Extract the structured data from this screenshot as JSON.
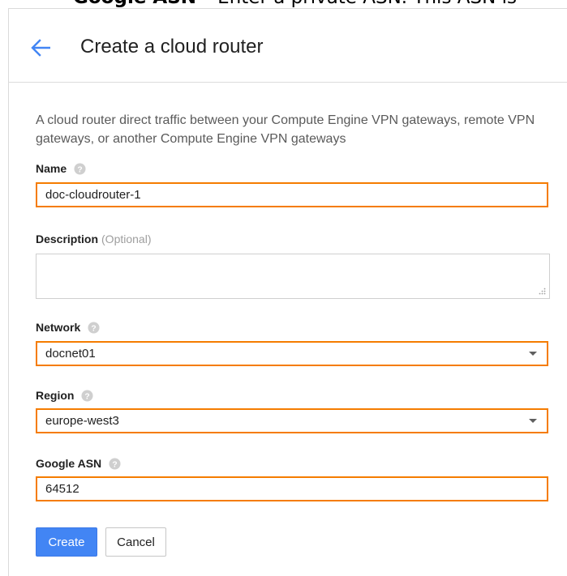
{
  "top_caption": {
    "bold": "Google ASN",
    "rest": " – Enter a private ASN. This ASN is"
  },
  "header": {
    "title": "Create a cloud router"
  },
  "intro_text": "A cloud router direct traffic between your Compute Engine VPN gateways, remote VPN gateways, or another Compute Engine VPN gateways",
  "fields": {
    "name": {
      "label": "Name",
      "value": "doc-cloudrouter-1"
    },
    "description": {
      "label": "Description",
      "optional": "(Optional)",
      "value": ""
    },
    "network": {
      "label": "Network",
      "value": "docnet01"
    },
    "region": {
      "label": "Region",
      "value": "europe-west3"
    },
    "google_asn": {
      "label": "Google ASN",
      "value": "64512"
    }
  },
  "buttons": {
    "create": "Create",
    "cancel": "Cancel"
  },
  "colors": {
    "accent_blue": "#4285f4",
    "focus_orange": "#f57c00"
  }
}
